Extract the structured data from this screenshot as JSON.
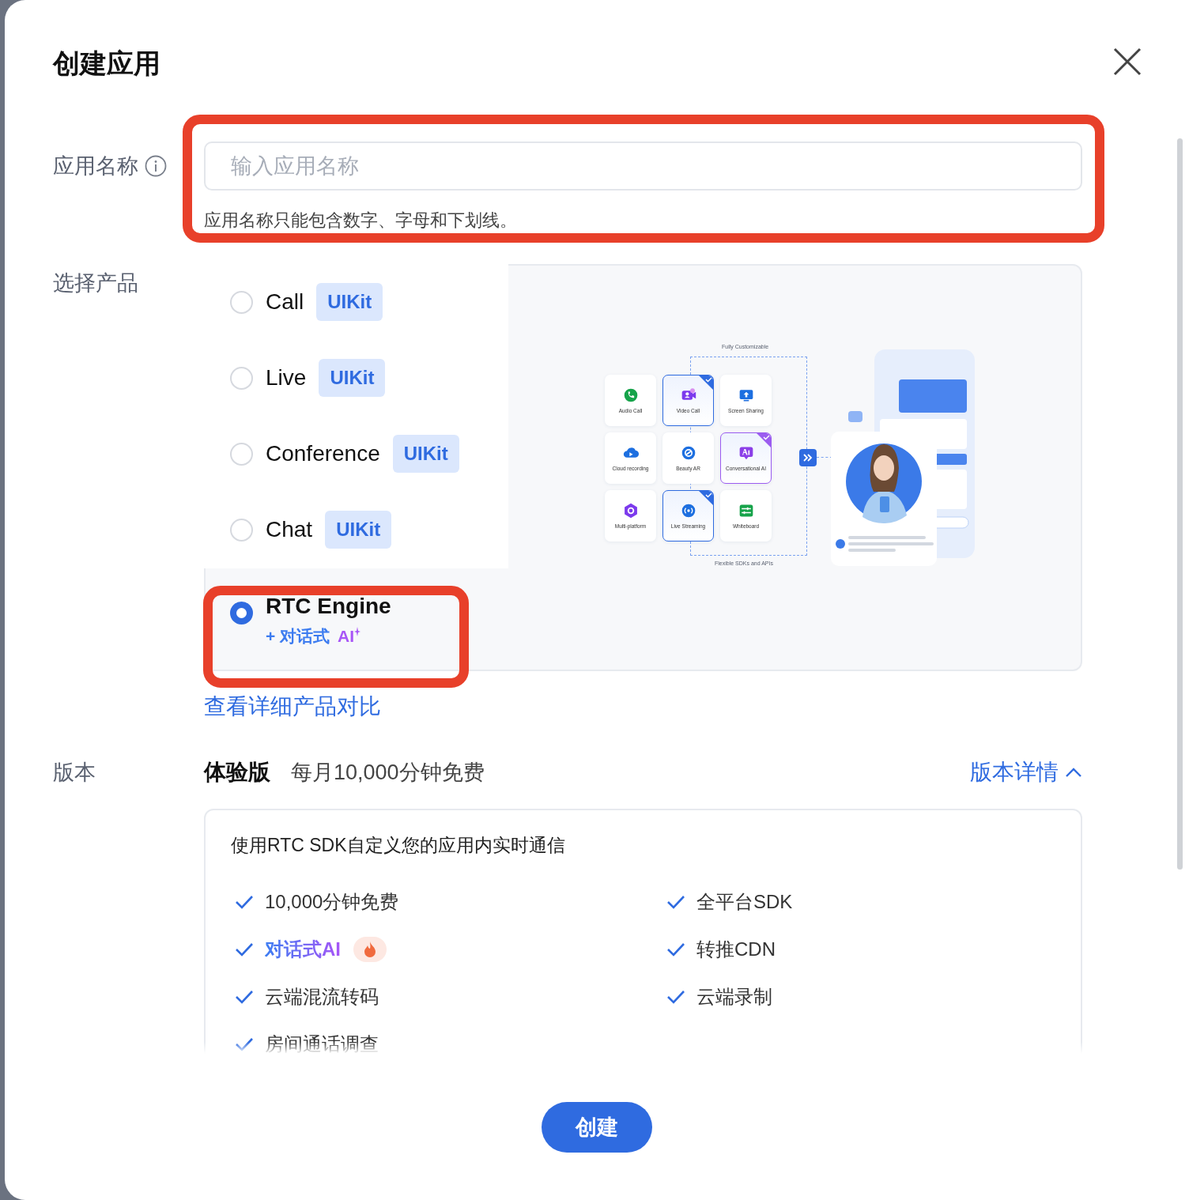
{
  "dialog": {
    "title": "创建应用"
  },
  "app_name": {
    "label": "应用名称",
    "placeholder": "输入应用名称",
    "hint": "应用名称只能包含数字、字母和下划线。",
    "highlighted": true
  },
  "product": {
    "label": "选择产品",
    "options": [
      {
        "name": "Call",
        "badge": "UIKit",
        "selected": false,
        "highlighted": false
      },
      {
        "name": "Live",
        "badge": "UIKit",
        "selected": false,
        "highlighted": false
      },
      {
        "name": "Conference",
        "badge": "UIKit",
        "selected": false,
        "highlighted": false
      },
      {
        "name": "Chat",
        "badge": "UIKit",
        "selected": false,
        "highlighted": false
      },
      {
        "name": "RTC Engine",
        "subtitle": "+ 对话式",
        "tag": "AI",
        "selected": true,
        "highlighted": true
      }
    ],
    "illustration": {
      "top_caption": "Fully Customizable",
      "bottom_caption": "Flexible SDKs and APIs",
      "tiles": [
        {
          "label": "Audio Call",
          "kind": "feature",
          "checked": false,
          "color": "#16a34a"
        },
        {
          "label": "Video Call",
          "kind": "feature",
          "checked": true,
          "color": "#7c3aed"
        },
        {
          "label": "Screen Sharing",
          "kind": "feature",
          "checked": false,
          "color": "#1d6fe0"
        },
        {
          "label": "Cloud recording",
          "kind": "feature",
          "checked": false,
          "color": "#1d6fe0"
        },
        {
          "label": "Beauty AR",
          "kind": "feature",
          "checked": false,
          "color": "#1d6fe0"
        },
        {
          "label": "Conversational AI",
          "kind": "ai",
          "checked": true,
          "color": "#8b3fe8"
        },
        {
          "label": "Multi-platform",
          "kind": "feature",
          "checked": false,
          "color": "#7c3aed"
        },
        {
          "label": "Live Streaming",
          "kind": "feature",
          "checked": true,
          "color": "#1d6fe0"
        },
        {
          "label": "Whiteboard",
          "kind": "feature",
          "checked": false,
          "color": "#16a34a"
        }
      ]
    }
  },
  "compare_link": "查看详细产品对比",
  "version": {
    "label": "版本",
    "name": "体验版",
    "summary": "每月10,000分钟免费",
    "details_link": "版本详情",
    "expanded": true
  },
  "plan": {
    "heading": "使用RTC SDK自定义您的应用内实时通信",
    "features": [
      {
        "text": "10,000分钟免费",
        "kind": "plain"
      },
      {
        "text": "全平台SDK",
        "kind": "plain"
      },
      {
        "text": "对话式AI",
        "kind": "ai"
      },
      {
        "text": "转推CDN",
        "kind": "plain"
      },
      {
        "text": "云端混流转码",
        "kind": "plain"
      },
      {
        "text": "云端录制",
        "kind": "plain"
      },
      {
        "text": "房间通话调查",
        "kind": "plain"
      }
    ]
  },
  "create_button": "创建"
}
